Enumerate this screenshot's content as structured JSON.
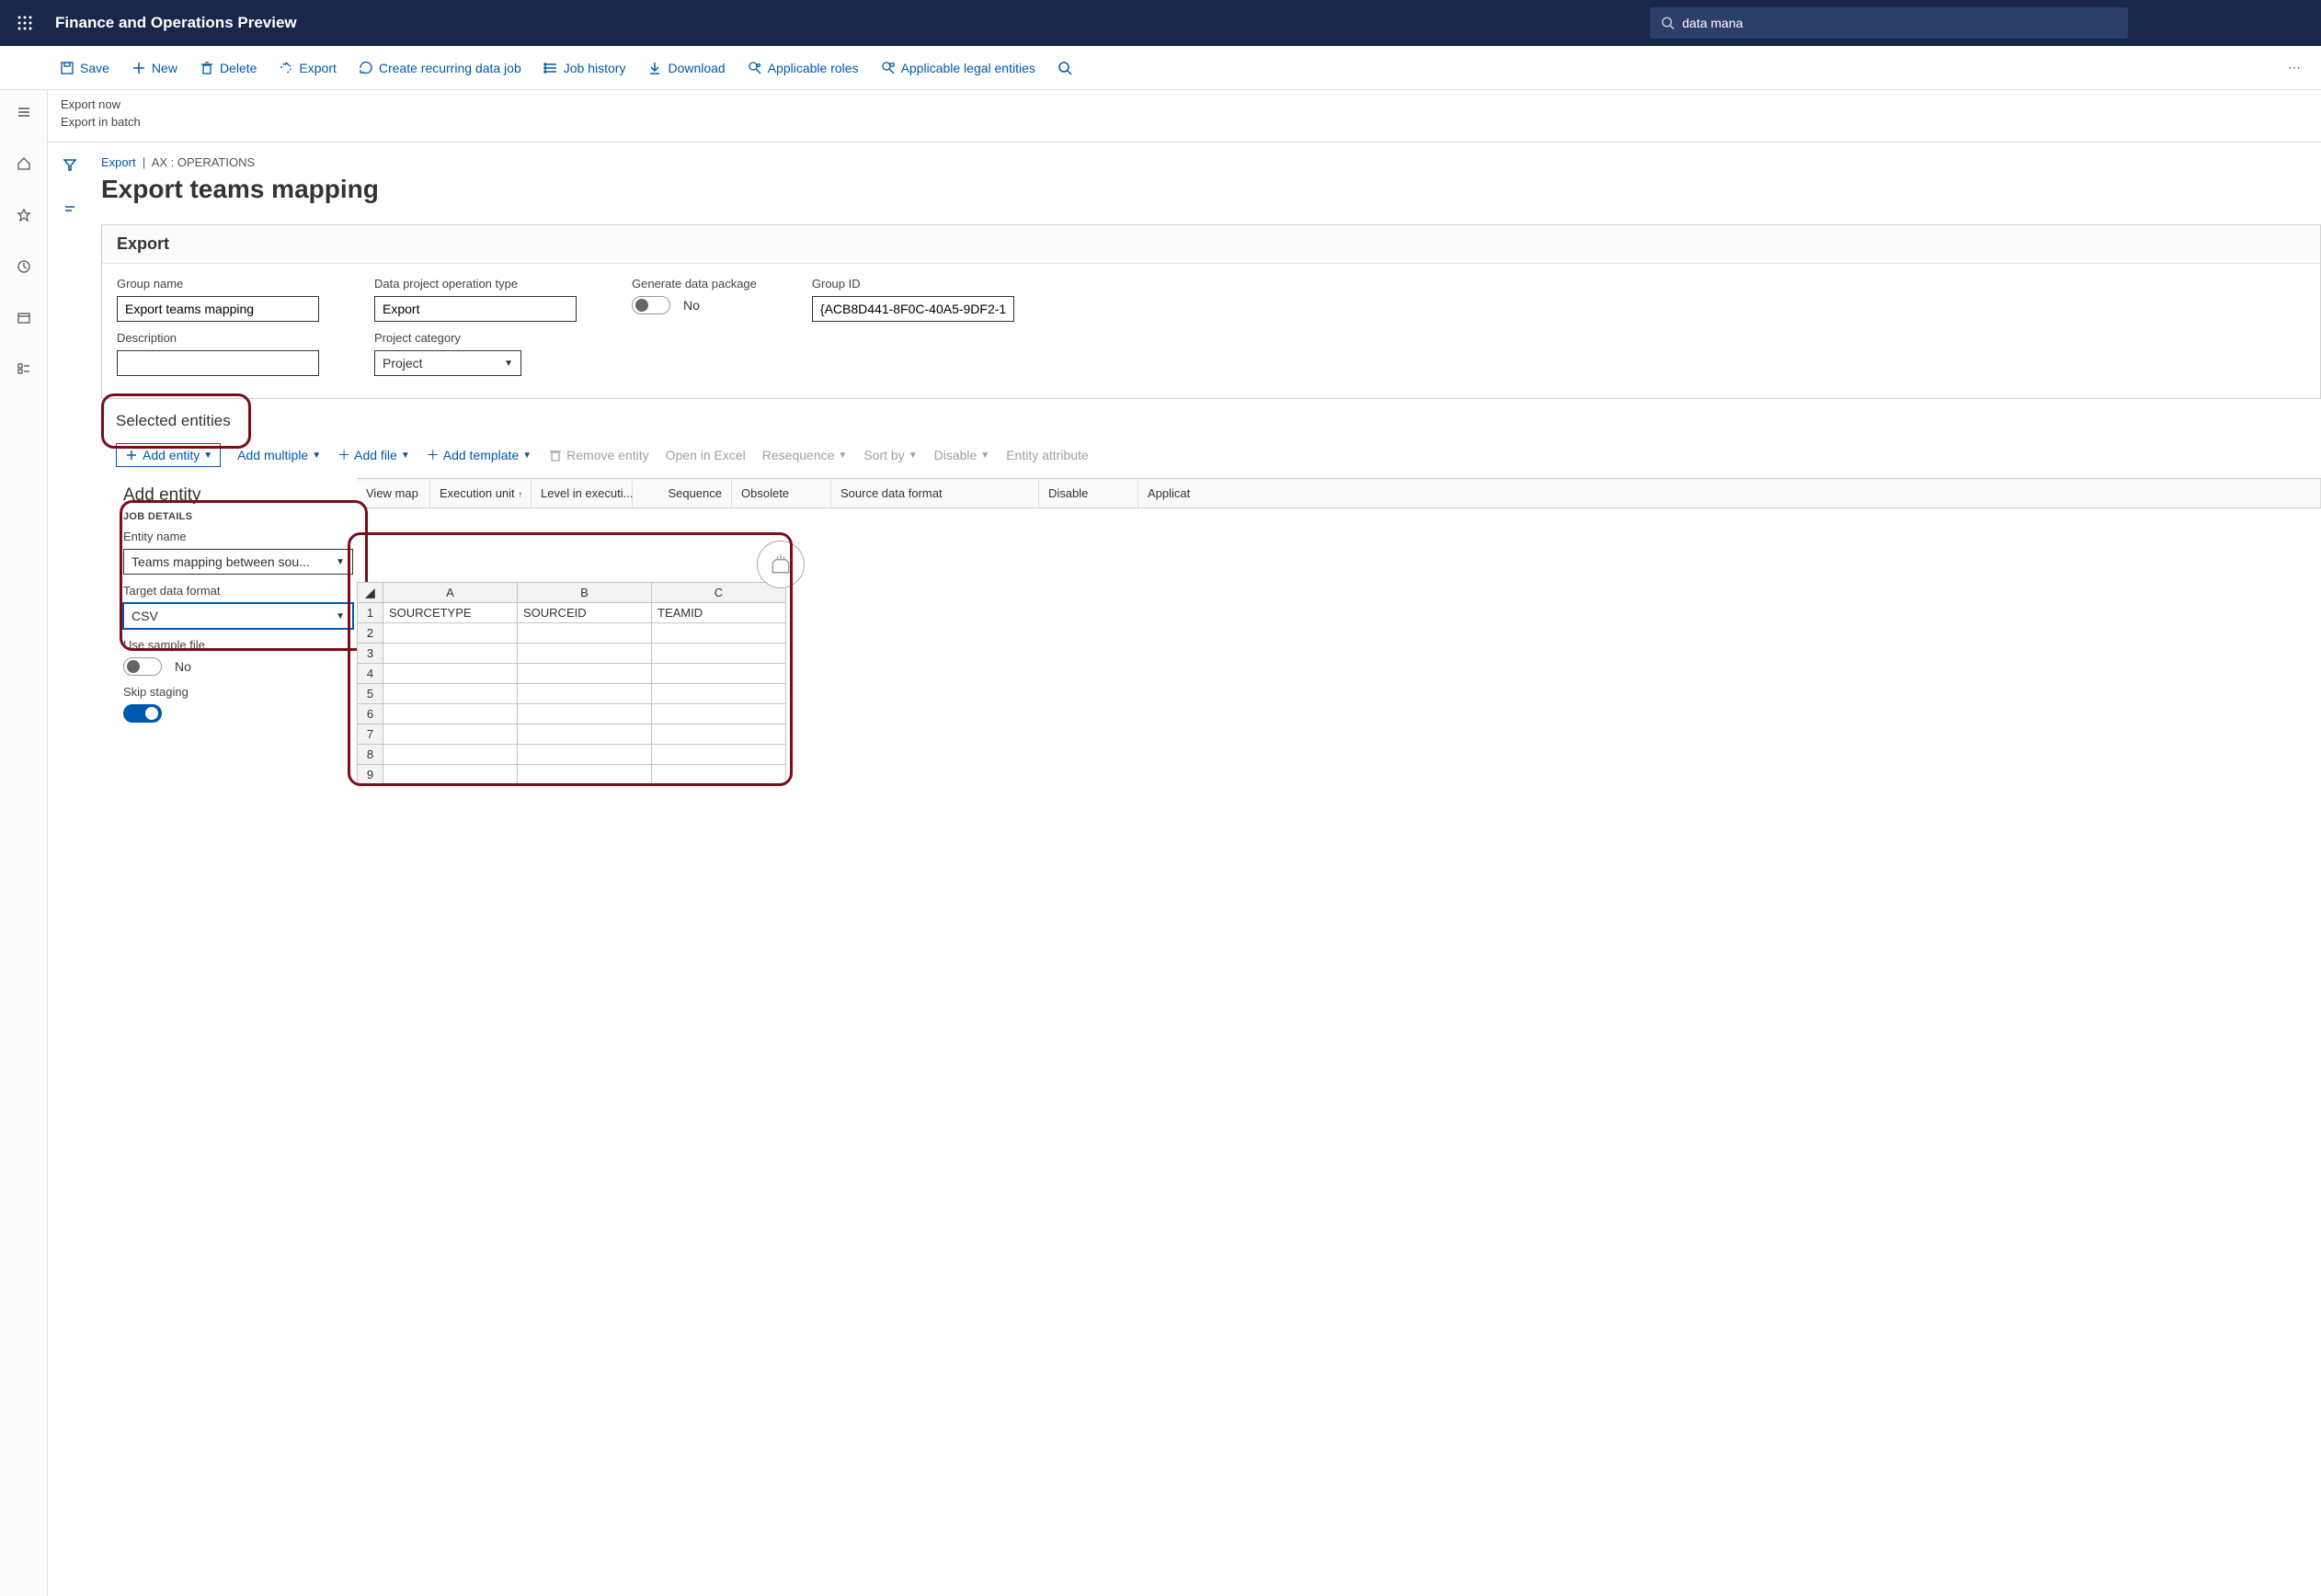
{
  "header": {
    "app_title": "Finance and Operations Preview",
    "search_value": "data mana"
  },
  "commands": {
    "save": "Save",
    "new": "New",
    "delete": "Delete",
    "export": "Export",
    "create_recurring": "Create recurring data job",
    "job_history": "Job history",
    "download": "Download",
    "applicable_roles": "Applicable roles",
    "applicable_le": "Applicable legal entities"
  },
  "subheader": {
    "export_now": "Export now",
    "export_batch": "Export in batch"
  },
  "breadcrumb": {
    "link": "Export",
    "tail": "AX : OPERATIONS"
  },
  "page_title": "Export teams mapping",
  "export_section": {
    "header": "Export",
    "fields": {
      "group_name_label": "Group name",
      "group_name_value": "Export teams mapping",
      "op_type_label": "Data project operation type",
      "op_type_value": "Export",
      "gen_pkg_label": "Generate data package",
      "gen_pkg_value": "No",
      "group_id_label": "Group ID",
      "group_id_value": "{ACB8D441-8F0C-40A5-9DF2-1...",
      "description_label": "Description",
      "description_value": "",
      "proj_cat_label": "Project category",
      "proj_cat_value": "Project"
    }
  },
  "entities": {
    "section_title": "Selected entities",
    "toolbar": {
      "add_entity": "Add entity",
      "add_multiple": "Add multiple",
      "add_file": "Add file",
      "add_template": "Add template",
      "remove_entity": "Remove entity",
      "open_excel": "Open in Excel",
      "resequence": "Resequence",
      "sort_by": "Sort by",
      "disable": "Disable",
      "entity_attribute": "Entity attribute"
    },
    "grid_headers": {
      "view_map": "View map",
      "execution_unit": "Execution unit",
      "level": "Level in executi...",
      "sequence": "Sequence",
      "obsolete": "Obsolete",
      "source_fmt": "Source data format",
      "disable": "Disable",
      "application": "Applicat"
    }
  },
  "add_entity_panel": {
    "title": "Add entity",
    "job_details": "JOB DETAILS",
    "entity_name_label": "Entity name",
    "entity_name_value": "Teams mapping between sou...",
    "target_fmt_label": "Target data format",
    "target_fmt_value": "CSV",
    "use_sample_label": "Use sample file",
    "use_sample_value": "No",
    "skip_staging_label": "Skip staging"
  },
  "sheet": {
    "cols": [
      "A",
      "B",
      "C"
    ],
    "row1": {
      "a": "SOURCETYPE",
      "b": "SOURCEID",
      "c": "TEAMID"
    },
    "rows": [
      "1",
      "2",
      "3",
      "4",
      "5",
      "6",
      "7",
      "8",
      "9"
    ]
  }
}
